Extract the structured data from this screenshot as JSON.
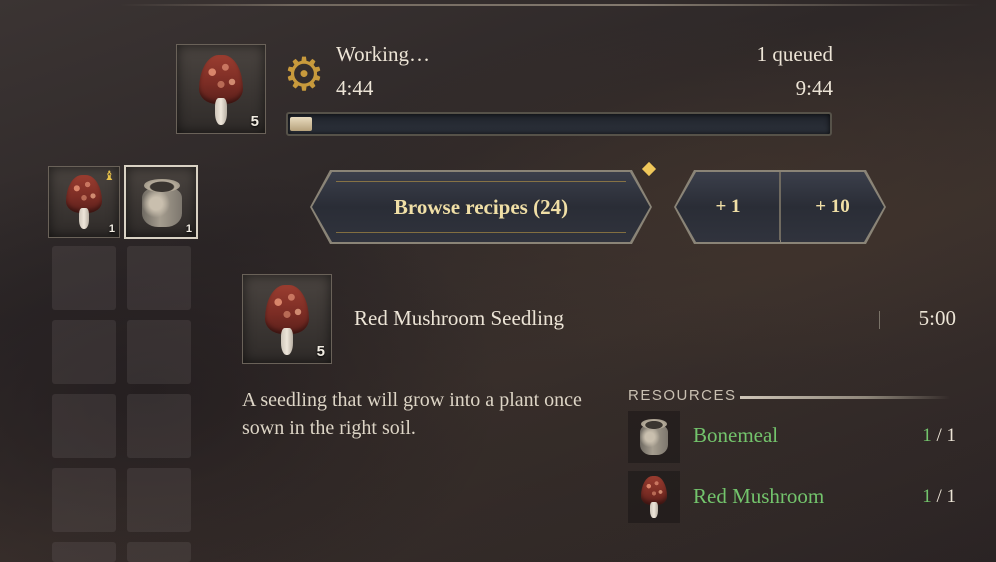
{
  "crafting": {
    "status": "Working…",
    "current_time": "4:44",
    "queued": "1 queued",
    "total_time": "9:44",
    "progress": 0.04,
    "output_qty": "5"
  },
  "ingredients_slots": [
    {
      "name": "Red Mushroom",
      "icon": "red-mushroom-icon",
      "qty": "1",
      "has_lock_badge": true
    },
    {
      "name": "Bonemeal",
      "icon": "bonemeal-icon",
      "qty": "1",
      "selected": true
    }
  ],
  "buttons": {
    "browse": "Browse recipes (24)",
    "plus_one": "+ 1",
    "plus_ten": "+ 10"
  },
  "recipe": {
    "name": "Red Mushroom Seedling",
    "qty": "5",
    "time": "5:00",
    "description": "A seedling that will grow into a plant once sown in the right soil."
  },
  "resources": {
    "heading": "RESOURCES",
    "items": [
      {
        "name": "Bonemeal",
        "have": "1",
        "sep": " / ",
        "need": "1",
        "icon": "bonemeal-icon"
      },
      {
        "name": "Red Mushroom",
        "have": "1",
        "sep": " / ",
        "need": "1",
        "icon": "red-mushroom-icon"
      }
    ]
  },
  "colors": {
    "accent_gold": "#c89a3c",
    "button_text": "#f0dfa6",
    "resource_ok": "#73c46c"
  }
}
